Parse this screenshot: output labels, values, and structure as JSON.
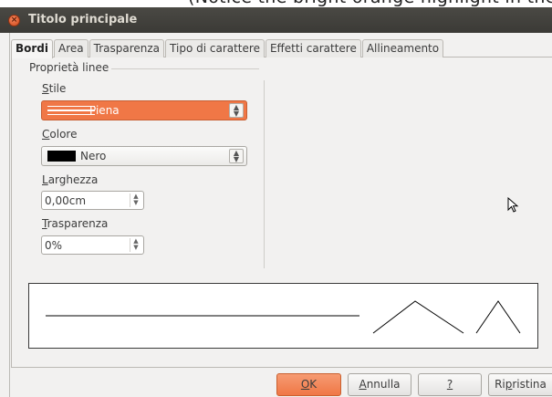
{
  "top_strip": {
    "text": "(Notice the bright orange highlight in the stile, it is not selected but in normal state)"
  },
  "window": {
    "title": "Titolo principale",
    "close_glyph": "×"
  },
  "tabs": [
    {
      "label": "Bordi",
      "active": true
    },
    {
      "label": "Area",
      "active": false
    },
    {
      "label": "Trasparenza",
      "active": false
    },
    {
      "label": "Tipo di carattere",
      "active": false
    },
    {
      "label": "Effetti carattere",
      "active": false
    },
    {
      "label": "Allineamento",
      "active": false
    }
  ],
  "line_properties": {
    "section_title": "Proprietà linee",
    "style": {
      "label_first": "S",
      "label_rest": "tile",
      "value": "Piena"
    },
    "color": {
      "label_first": "C",
      "label_rest": "olore",
      "value": "Nero",
      "swatch": "#000000"
    },
    "width": {
      "label_first": "L",
      "label_rest": "arghezza",
      "value": "0,00cm"
    },
    "transparency": {
      "label_first": "T",
      "label_rest": "rasparenza",
      "value": "0%"
    }
  },
  "icons": {
    "select_arrow": "up-down-arrows",
    "spin_arrow": "up-down-arrows",
    "cursor": "mouse-pointer-icon"
  },
  "buttons": {
    "ok": {
      "first": "O",
      "rest": "K"
    },
    "cancel": {
      "first": "A",
      "rest": "nnulla"
    },
    "help": {
      "first": "?",
      "rest": ""
    },
    "reset": {
      "before": "Ri",
      "ul": "p",
      "after": "ristina"
    }
  },
  "colors": {
    "accent": "#f07746",
    "titlebar": "#3b3a36",
    "dialog_bg": "#f2f1f0"
  }
}
